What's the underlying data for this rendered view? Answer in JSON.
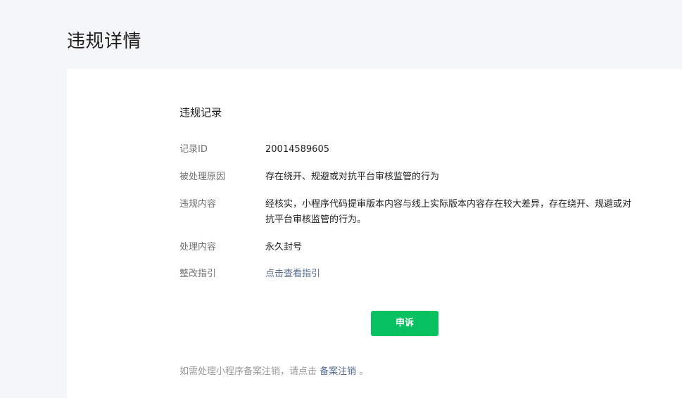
{
  "header": {
    "title": "违规详情"
  },
  "record": {
    "section_title": "违规记录",
    "rows": [
      {
        "label": "记录ID",
        "value": "20014589605"
      },
      {
        "label": "被处理原因",
        "value": "存在绕开、规避或对抗平台审核监管的行为"
      },
      {
        "label": "违规内容",
        "value": "经核实，小程序代码提审版本内容与线上实际版本内容存在较大差异，存在绕开、规避或对抗平台审核监管的行为。"
      },
      {
        "label": "处理内容",
        "value": "永久封号"
      },
      {
        "label": "整改指引",
        "value": "点击查看指引"
      }
    ]
  },
  "actions": {
    "appeal_label": "申诉"
  },
  "footer": {
    "prefix": "如需处理小程序备案注销，请点击 ",
    "link_text": "备案注销",
    "suffix": " 。"
  },
  "colors": {
    "accent_green": "#07c160",
    "link_blue": "#576b95",
    "background": "#f5f6f7"
  }
}
